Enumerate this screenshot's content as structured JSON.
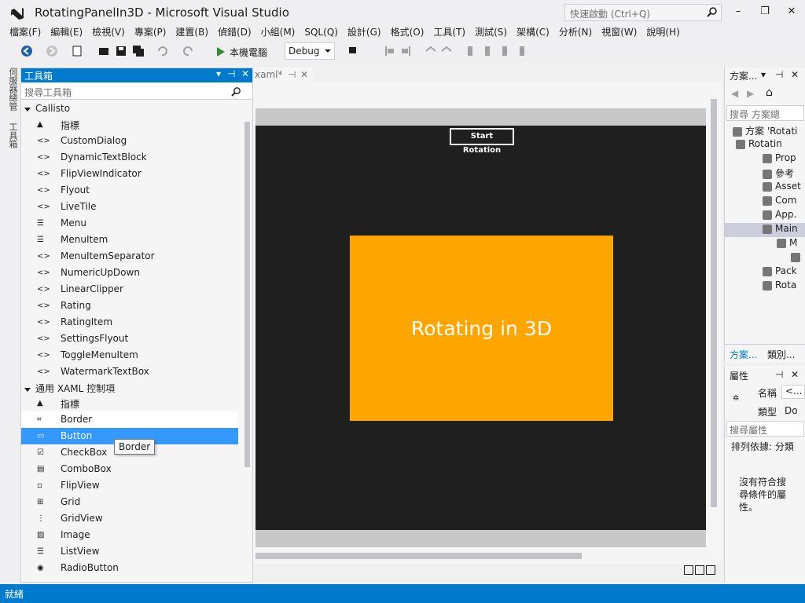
{
  "window": {
    "title": "RotatingPanelIn3D - Microsoft Visual Studio",
    "quick_launch_placeholder": "快速啟動 (Ctrl+Q)",
    "min": "–",
    "max": "❐",
    "close": "✕"
  },
  "menu": [
    "檔案(F)",
    "編輯(E)",
    "檢視(V)",
    "專案(P)",
    "建置(B)",
    "偵錯(D)",
    "小組(M)",
    "SQL(Q)",
    "設計(G)",
    "格式(O)",
    "工具(T)",
    "測試(S)",
    "架構(C)",
    "分析(N)",
    "視窗(W)",
    "說明(H)"
  ],
  "toolbar": {
    "run_label": "本機電腦",
    "config": "Debug"
  },
  "left_tabs": [
    "伺服器總管",
    "工具箱"
  ],
  "toolbox": {
    "title": "工具箱",
    "search_placeholder": "搜尋工具箱",
    "group1": "Callisto",
    "group1_items": [
      "指標",
      "CustomDialog",
      "DynamicTextBlock",
      "FlipViewIndicator",
      "Flyout",
      "LiveTile",
      "Menu",
      "MenuItem",
      "MenuItemSeparator",
      "NumericUpDown",
      "LinearClipper",
      "Rating",
      "RatingItem",
      "SettingsFlyout",
      "ToggleMenuItem",
      "WatermarkTextBox"
    ],
    "group2": "通用 XAML 控制項",
    "group2_items": [
      "指標",
      "Border",
      "Button",
      "CheckBox",
      "ComboBox",
      "FlipView",
      "Grid",
      "GridView",
      "Image",
      "ListView",
      "RadioButton"
    ],
    "tooltip": "Border"
  },
  "document": {
    "tab_label": "xaml*",
    "button_label": "Start Rotation",
    "panel_text": "Rotating in 3D",
    "colors": {
      "canvas": "#1f1f1f",
      "panel": "#ffa500"
    }
  },
  "solution": {
    "title": "方案...",
    "search_placeholder": "搜尋 方案總",
    "rows": [
      "方案 'Rotati",
      "Rotatin",
      "Prop",
      "參考",
      "Asset",
      "Com",
      "App.",
      "Main",
      "M",
      "",
      "Pack",
      "Rota"
    ],
    "tabs": [
      "方案...",
      "類別..."
    ]
  },
  "properties": {
    "title": "屬性",
    "name_label": "名稱",
    "name_value": "<...",
    "type_label": "類型",
    "type_value": "Do",
    "search_placeholder": "搜尋屬性",
    "sort_label": "排列依據: 分類",
    "empty_msg": "沒有符合搜尋條件的屬性。"
  },
  "status": {
    "text": "就緒"
  }
}
